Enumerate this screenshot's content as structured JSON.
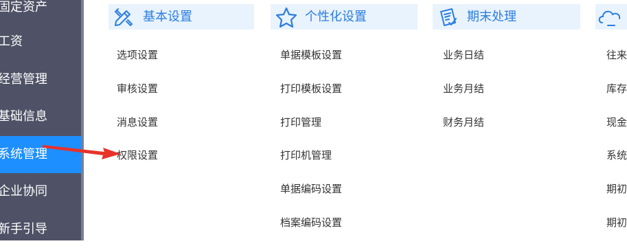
{
  "sidebar": {
    "items": [
      {
        "label": "固定资产"
      },
      {
        "label": "工资"
      },
      {
        "label": "经营管理"
      },
      {
        "label": "基础信息"
      },
      {
        "label": "系统管理"
      },
      {
        "label": "企业协同"
      },
      {
        "label": "新手引导"
      }
    ]
  },
  "groups": [
    {
      "title": "基本设置",
      "icon": "pencil-ruler-icon",
      "items": [
        "选项设置",
        "审核设置",
        "消息设置",
        "权限设置"
      ]
    },
    {
      "title": "个性化设置",
      "icon": "star-icon",
      "items": [
        "单据模板设置",
        "打印模板设置",
        "打印管理",
        "打印机管理",
        "单据编码设置",
        "档案编码设置"
      ]
    },
    {
      "title": "期末处理",
      "icon": "checklist-icon",
      "items": [
        "业务日结",
        "业务月结",
        "财务月结"
      ]
    },
    {
      "title": "",
      "icon": "cloud-icon",
      "items": [
        "往来",
        "库存",
        "现金",
        "系统",
        "期初",
        "期初"
      ]
    }
  ],
  "colors": {
    "sidebar_bg": "#4f5266",
    "active_bg": "#1e8fff",
    "header_bg": "#e9f3fd",
    "header_text": "#2a7de1",
    "arrow": "#e8322a"
  }
}
